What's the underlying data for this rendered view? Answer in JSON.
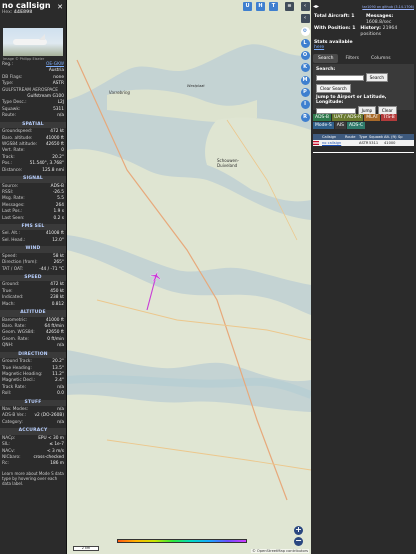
{
  "aircraft": {
    "callsign": "no callsign",
    "hex_label": "Hex:",
    "hex": "44E898",
    "photo_credit": "Image © Philipp Eiseler"
  },
  "details": [
    {
      "k": "Reg.:",
      "v": "OE-GKW",
      "link": true
    },
    {
      "k": "",
      "v": "Austria"
    },
    {
      "k": "DB Flags:",
      "v": "none"
    },
    {
      "k": "Type:",
      "v": "ASTR"
    },
    {
      "k": "GULFSTREAM AEROSPACE",
      "v": "",
      "full": true
    },
    {
      "k": "",
      "v": "Gulfstream G100"
    },
    {
      "k": "Type Desc.:",
      "v": "L2J"
    },
    {
      "k": "Squawk:",
      "v": "5311"
    },
    {
      "k": "Route:",
      "v": "n/a"
    }
  ],
  "sections": {
    "spatial": "SPATIAL",
    "signal": "SIGNAL",
    "fms": "FMS SEL",
    "wind": "WIND",
    "speed": "SPEED",
    "altitude": "ALTITUDE",
    "direction": "DIRECTION",
    "stuff": "STUFF",
    "accuracy": "ACCURACY"
  },
  "spatial": [
    {
      "k": "Groundspeed:",
      "v": "472 kt"
    },
    {
      "k": "Baro. altitude:",
      "v": "41000 ft"
    },
    {
      "k": "WGS84 altitude:",
      "v": "42650 ft"
    },
    {
      "k": "Vert. Rate:",
      "v": "0"
    },
    {
      "k": "Track:",
      "v": "20.2°"
    },
    {
      "k": "Pos.:",
      "v": "51.540°, 3.768°"
    },
    {
      "k": "Distance:",
      "v": "125.8 nmi"
    }
  ],
  "signal": [
    {
      "k": "Source:",
      "v": "ADS-B"
    },
    {
      "k": "RSSI:",
      "v": "-26.5"
    },
    {
      "k": "Msg. Rate:",
      "v": "5.5"
    },
    {
      "k": "Messages:",
      "v": "264"
    },
    {
      "k": "Last Pos.:",
      "v": "1.9 s"
    },
    {
      "k": "Last Seen:",
      "v": "0.2 s"
    }
  ],
  "fms": [
    {
      "k": "Sel. Alt.:",
      "v": "41008 ft"
    },
    {
      "k": "Sel. Head.:",
      "v": "12.0°"
    }
  ],
  "wind": [
    {
      "k": "Speed:",
      "v": "58 kt"
    },
    {
      "k": "Direction (from):",
      "v": "265°"
    },
    {
      "k": "TAT / OAT:",
      "v": "-44 / -71 °C"
    }
  ],
  "speed": [
    {
      "k": "Ground:",
      "v": "472 kt"
    },
    {
      "k": "True:",
      "v": "450 kt"
    },
    {
      "k": "Indicated:",
      "v": "238 kt"
    },
    {
      "k": "Mach:",
      "v": "0.812"
    }
  ],
  "altitude": [
    {
      "k": "Barometric:",
      "v": "41000 ft"
    },
    {
      "k": "Baro. Rate:",
      "v": "64 ft/min"
    },
    {
      "k": "Geom. WGS84:",
      "v": "42650 ft"
    },
    {
      "k": "Geom. Rate:",
      "v": "0 ft/min"
    },
    {
      "k": "QNH:",
      "v": "n/a"
    }
  ],
  "direction": [
    {
      "k": "Ground Track:",
      "v": "20.2°"
    },
    {
      "k": "True Heading:",
      "v": "13.5°"
    },
    {
      "k": "Magnetic Heading:",
      "v": "11.2°"
    },
    {
      "k": "Magnetic Decl.:",
      "v": "2.4°"
    },
    {
      "k": "Track Rate:",
      "v": "n/a"
    },
    {
      "k": "Roll:",
      "v": "0.0"
    }
  ],
  "stuff": [
    {
      "k": "Nav. Modes:",
      "v": "n/a"
    },
    {
      "k": "ADS-B Ver.:",
      "v": "v2 (DO-260B)"
    },
    {
      "k": "Category:",
      "v": "n/a"
    }
  ],
  "accuracy": [
    {
      "k": "NACp:",
      "v": "EPU < 30 m"
    },
    {
      "k": "SIL:",
      "v": "≤ 1e-7"
    },
    {
      "k": "NACv:",
      "v": "< 3 m/s"
    },
    {
      "k": "NICbaro:",
      "v": "cross-checked"
    },
    {
      "k": "Rc:",
      "v": "186 m"
    }
  ],
  "footer_note": "Learn more about Mode S data type by hovering over each data label.",
  "map": {
    "btn_u": "U",
    "btn_h": "H",
    "btn_t": "T",
    "labels": {
      "schouwen": "Schouwen-\nDuiveland",
      "varnebrg": "Varrebring",
      "westplaat": "Westplaat"
    },
    "scale": "2 km",
    "attribution": "© OpenStreetMap contributors",
    "color_ticks": [
      "",
      "",
      "",
      "",
      "",
      "",
      "",
      ""
    ]
  },
  "toolbar": [
    "L",
    "O",
    "K",
    "M",
    "P",
    "I",
    "R"
  ],
  "right": {
    "version": "tar1090 on github (3.14.1706)",
    "total_aircraft_label": "Total Aircraft:",
    "total_aircraft": "1",
    "messages_label": "Messages:",
    "messages_rate": "1608.8/sec",
    "with_position_label": "With Position:",
    "with_position": "1",
    "history_label": "History:",
    "history": "21964 positions",
    "stats_available": "Stats available",
    "stats_link": "here",
    "tabs": [
      "Search",
      "Filters",
      "Columns"
    ],
    "search_label": "Search:",
    "search_button": "Search",
    "clear_search": "Clear Search",
    "jump_label": "Jump to Airport or Latitude, Longitude:",
    "jump_button": "Jump",
    "clear_button": "Clear",
    "filters": [
      {
        "label": "ADS-B",
        "color": "#2f7a4d"
      },
      {
        "label": "UAT / ADS-R",
        "color": "#6a7a2f"
      },
      {
        "label": "MLAT",
        "color": "#a86a2a"
      },
      {
        "label": "TIS-B",
        "color": "#b33b3b"
      },
      {
        "label": "Mode-S",
        "color": "#2f5f8a"
      },
      {
        "label": "AIS",
        "color": "#3a3a3a"
      },
      {
        "label": "ADS-C",
        "color": "#2f7a6a"
      }
    ],
    "table_headers": [
      "",
      "Callsign",
      "Route",
      "Type",
      "Squawk",
      "Alt. (ft)",
      "Sp"
    ],
    "table_rows": [
      {
        "callsign": "no callsign",
        "route": "",
        "type": "ASTR",
        "squawk": "5311",
        "alt": "41000"
      }
    ]
  },
  "colors": {
    "panel": "#2b2b2b",
    "accent": "#3e7fcf",
    "section_title": "#b9d0ff",
    "aircraft_marker": "#c83cd6"
  }
}
